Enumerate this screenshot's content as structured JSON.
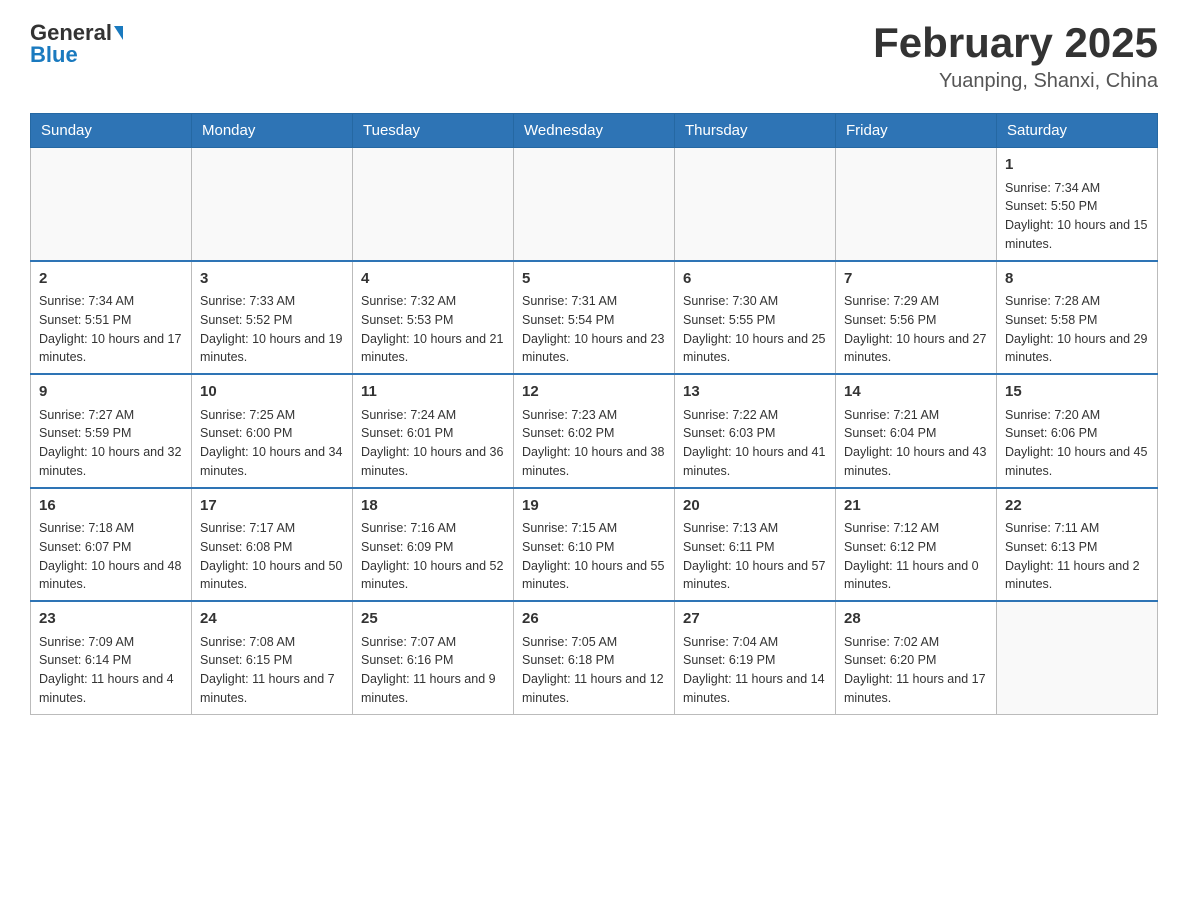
{
  "header": {
    "logo_general": "General",
    "logo_blue": "Blue",
    "title": "February 2025",
    "subtitle": "Yuanping, Shanxi, China"
  },
  "days_of_week": [
    "Sunday",
    "Monday",
    "Tuesday",
    "Wednesday",
    "Thursday",
    "Friday",
    "Saturday"
  ],
  "weeks": [
    [
      {
        "day": "",
        "sunrise": "",
        "sunset": "",
        "daylight": ""
      },
      {
        "day": "",
        "sunrise": "",
        "sunset": "",
        "daylight": ""
      },
      {
        "day": "",
        "sunrise": "",
        "sunset": "",
        "daylight": ""
      },
      {
        "day": "",
        "sunrise": "",
        "sunset": "",
        "daylight": ""
      },
      {
        "day": "",
        "sunrise": "",
        "sunset": "",
        "daylight": ""
      },
      {
        "day": "",
        "sunrise": "",
        "sunset": "",
        "daylight": ""
      },
      {
        "day": "1",
        "sunrise": "Sunrise: 7:34 AM",
        "sunset": "Sunset: 5:50 PM",
        "daylight": "Daylight: 10 hours and 15 minutes."
      }
    ],
    [
      {
        "day": "2",
        "sunrise": "Sunrise: 7:34 AM",
        "sunset": "Sunset: 5:51 PM",
        "daylight": "Daylight: 10 hours and 17 minutes."
      },
      {
        "day": "3",
        "sunrise": "Sunrise: 7:33 AM",
        "sunset": "Sunset: 5:52 PM",
        "daylight": "Daylight: 10 hours and 19 minutes."
      },
      {
        "day": "4",
        "sunrise": "Sunrise: 7:32 AM",
        "sunset": "Sunset: 5:53 PM",
        "daylight": "Daylight: 10 hours and 21 minutes."
      },
      {
        "day": "5",
        "sunrise": "Sunrise: 7:31 AM",
        "sunset": "Sunset: 5:54 PM",
        "daylight": "Daylight: 10 hours and 23 minutes."
      },
      {
        "day": "6",
        "sunrise": "Sunrise: 7:30 AM",
        "sunset": "Sunset: 5:55 PM",
        "daylight": "Daylight: 10 hours and 25 minutes."
      },
      {
        "day": "7",
        "sunrise": "Sunrise: 7:29 AM",
        "sunset": "Sunset: 5:56 PM",
        "daylight": "Daylight: 10 hours and 27 minutes."
      },
      {
        "day": "8",
        "sunrise": "Sunrise: 7:28 AM",
        "sunset": "Sunset: 5:58 PM",
        "daylight": "Daylight: 10 hours and 29 minutes."
      }
    ],
    [
      {
        "day": "9",
        "sunrise": "Sunrise: 7:27 AM",
        "sunset": "Sunset: 5:59 PM",
        "daylight": "Daylight: 10 hours and 32 minutes."
      },
      {
        "day": "10",
        "sunrise": "Sunrise: 7:25 AM",
        "sunset": "Sunset: 6:00 PM",
        "daylight": "Daylight: 10 hours and 34 minutes."
      },
      {
        "day": "11",
        "sunrise": "Sunrise: 7:24 AM",
        "sunset": "Sunset: 6:01 PM",
        "daylight": "Daylight: 10 hours and 36 minutes."
      },
      {
        "day": "12",
        "sunrise": "Sunrise: 7:23 AM",
        "sunset": "Sunset: 6:02 PM",
        "daylight": "Daylight: 10 hours and 38 minutes."
      },
      {
        "day": "13",
        "sunrise": "Sunrise: 7:22 AM",
        "sunset": "Sunset: 6:03 PM",
        "daylight": "Daylight: 10 hours and 41 minutes."
      },
      {
        "day": "14",
        "sunrise": "Sunrise: 7:21 AM",
        "sunset": "Sunset: 6:04 PM",
        "daylight": "Daylight: 10 hours and 43 minutes."
      },
      {
        "day": "15",
        "sunrise": "Sunrise: 7:20 AM",
        "sunset": "Sunset: 6:06 PM",
        "daylight": "Daylight: 10 hours and 45 minutes."
      }
    ],
    [
      {
        "day": "16",
        "sunrise": "Sunrise: 7:18 AM",
        "sunset": "Sunset: 6:07 PM",
        "daylight": "Daylight: 10 hours and 48 minutes."
      },
      {
        "day": "17",
        "sunrise": "Sunrise: 7:17 AM",
        "sunset": "Sunset: 6:08 PM",
        "daylight": "Daylight: 10 hours and 50 minutes."
      },
      {
        "day": "18",
        "sunrise": "Sunrise: 7:16 AM",
        "sunset": "Sunset: 6:09 PM",
        "daylight": "Daylight: 10 hours and 52 minutes."
      },
      {
        "day": "19",
        "sunrise": "Sunrise: 7:15 AM",
        "sunset": "Sunset: 6:10 PM",
        "daylight": "Daylight: 10 hours and 55 minutes."
      },
      {
        "day": "20",
        "sunrise": "Sunrise: 7:13 AM",
        "sunset": "Sunset: 6:11 PM",
        "daylight": "Daylight: 10 hours and 57 minutes."
      },
      {
        "day": "21",
        "sunrise": "Sunrise: 7:12 AM",
        "sunset": "Sunset: 6:12 PM",
        "daylight": "Daylight: 11 hours and 0 minutes."
      },
      {
        "day": "22",
        "sunrise": "Sunrise: 7:11 AM",
        "sunset": "Sunset: 6:13 PM",
        "daylight": "Daylight: 11 hours and 2 minutes."
      }
    ],
    [
      {
        "day": "23",
        "sunrise": "Sunrise: 7:09 AM",
        "sunset": "Sunset: 6:14 PM",
        "daylight": "Daylight: 11 hours and 4 minutes."
      },
      {
        "day": "24",
        "sunrise": "Sunrise: 7:08 AM",
        "sunset": "Sunset: 6:15 PM",
        "daylight": "Daylight: 11 hours and 7 minutes."
      },
      {
        "day": "25",
        "sunrise": "Sunrise: 7:07 AM",
        "sunset": "Sunset: 6:16 PM",
        "daylight": "Daylight: 11 hours and 9 minutes."
      },
      {
        "day": "26",
        "sunrise": "Sunrise: 7:05 AM",
        "sunset": "Sunset: 6:18 PM",
        "daylight": "Daylight: 11 hours and 12 minutes."
      },
      {
        "day": "27",
        "sunrise": "Sunrise: 7:04 AM",
        "sunset": "Sunset: 6:19 PM",
        "daylight": "Daylight: 11 hours and 14 minutes."
      },
      {
        "day": "28",
        "sunrise": "Sunrise: 7:02 AM",
        "sunset": "Sunset: 6:20 PM",
        "daylight": "Daylight: 11 hours and 17 minutes."
      },
      {
        "day": "",
        "sunrise": "",
        "sunset": "",
        "daylight": ""
      }
    ]
  ]
}
